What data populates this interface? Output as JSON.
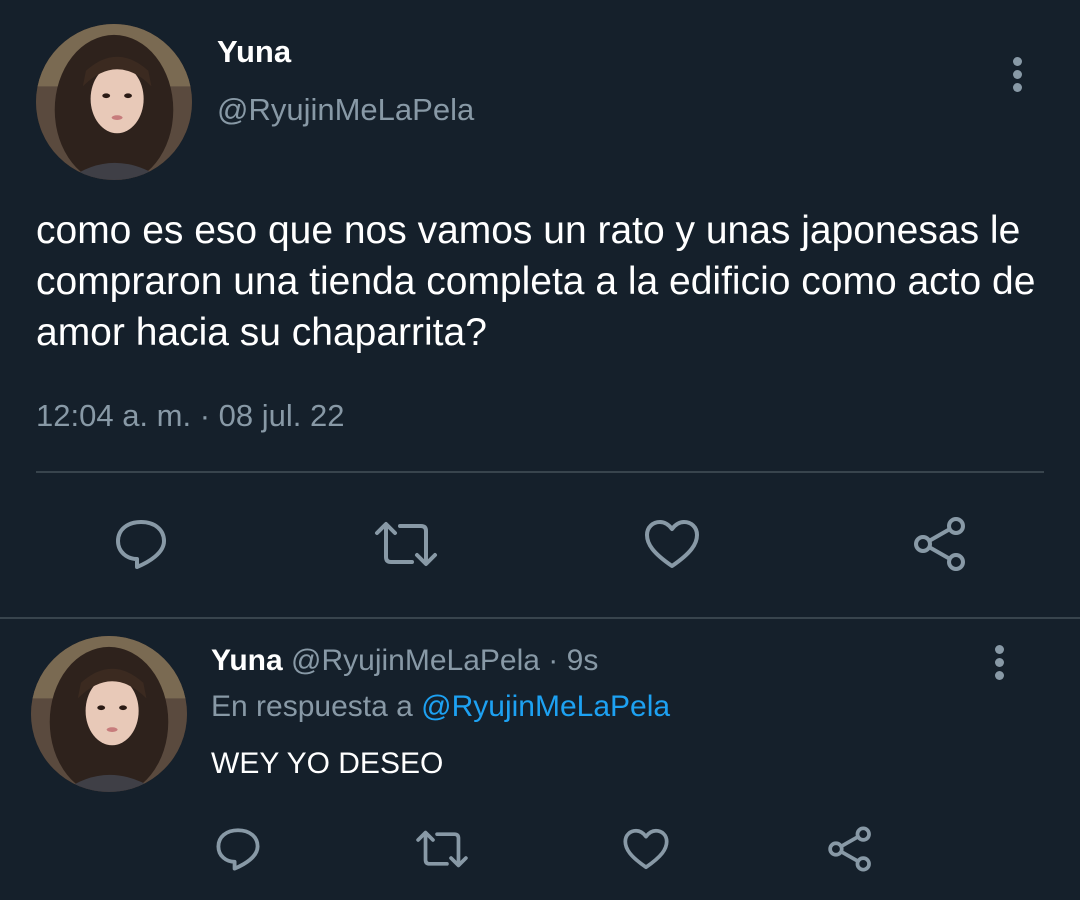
{
  "main_tweet": {
    "author_name": "Yuna",
    "author_handle": "@RyujinMeLaPela",
    "text": "como es eso que nos vamos un rato y unas japonesas le compraron una tienda completa a la edificio como acto de amor hacia su chaparrita?",
    "timestamp": "12:04 a. m. · 08 jul. 22",
    "actions": [
      "reply-icon",
      "retweet-icon",
      "like-icon",
      "share-icon"
    ],
    "more_icon": "more-vertical-icon"
  },
  "reply": {
    "author_name": "Yuna",
    "author_handle": "@RyujinMeLaPela",
    "separator": "·",
    "age": "9s",
    "replying_to_prefix": "En respuesta a",
    "replying_to_handle": "@RyujinMeLaPela",
    "text": "WEY YO DESEO",
    "actions": [
      "reply-icon",
      "retweet-icon",
      "like-icon",
      "share-icon"
    ],
    "more_icon": "more-vertical-icon"
  },
  "colors": {
    "background": "#15202b",
    "text_primary": "#ffffff",
    "text_secondary": "#8899a6",
    "link": "#1da1f2",
    "divider": "#38444d"
  }
}
